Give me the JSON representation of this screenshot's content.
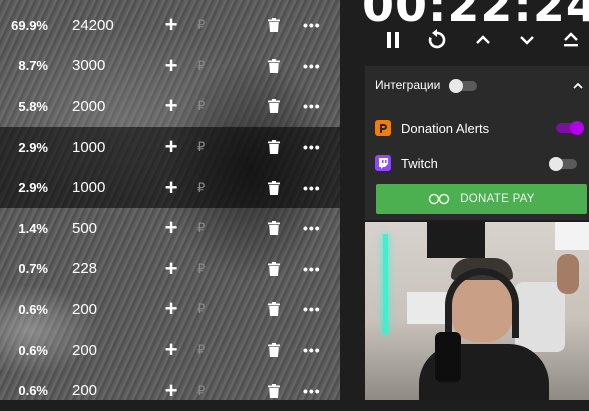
{
  "timer": {
    "text": "00:22:24"
  },
  "rows": [
    {
      "pct": "69.9%",
      "amount": "24200"
    },
    {
      "pct": "8.7%",
      "amount": "3000"
    },
    {
      "pct": "5.8%",
      "amount": "2000"
    },
    {
      "pct": "2.9%",
      "amount": "1000"
    },
    {
      "pct": "2.9%",
      "amount": "1000"
    },
    {
      "pct": "1.4%",
      "amount": "500"
    },
    {
      "pct": "0.7%",
      "amount": "228"
    },
    {
      "pct": "0.6%",
      "amount": "200"
    },
    {
      "pct": "0.6%",
      "amount": "200"
    },
    {
      "pct": "0.6%",
      "amount": "200"
    }
  ],
  "row_labels": {
    "plus": "+",
    "currency": "₽",
    "more": "•••"
  },
  "integrations": {
    "title": "Интеграции",
    "enabled": false,
    "items": [
      {
        "label": "Donation Alerts",
        "icon": "donationalerts-icon",
        "enabled": true,
        "color": "#f57d07"
      },
      {
        "label": "Twitch",
        "icon": "twitch-icon",
        "enabled": false,
        "color": "#9146ff"
      }
    ],
    "donate_button": "DONATE PAY"
  },
  "colors": {
    "accent_toggle": "#b400e8",
    "donate_green": "#4caf50"
  }
}
